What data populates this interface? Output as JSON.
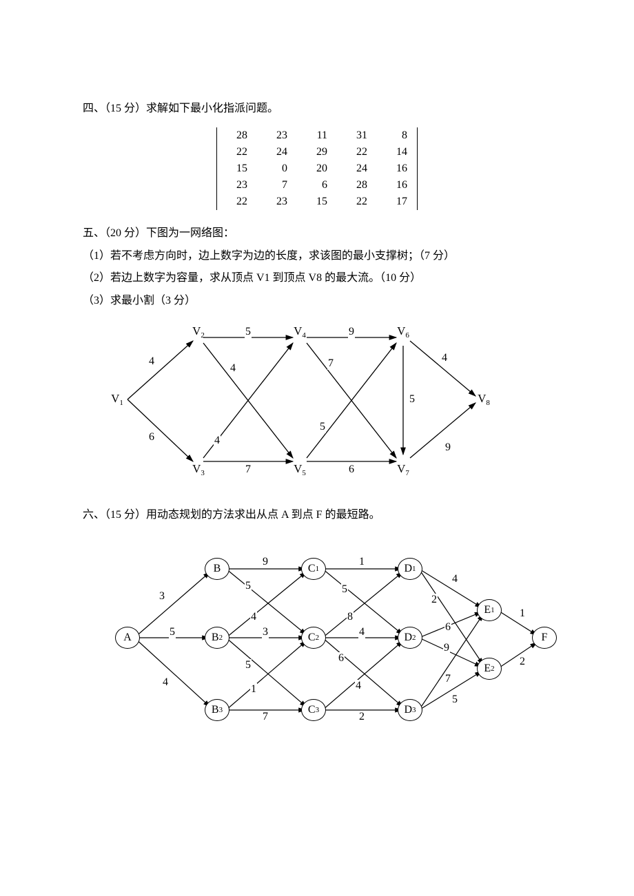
{
  "q4": {
    "heading": "四、（15 分）求解如下最小化指派问题。",
    "matrix": [
      [
        28,
        23,
        11,
        31,
        8
      ],
      [
        22,
        24,
        29,
        22,
        14
      ],
      [
        15,
        0,
        20,
        24,
        16
      ],
      [
        23,
        7,
        6,
        28,
        16
      ],
      [
        22,
        23,
        15,
        22,
        17
      ]
    ]
  },
  "q5": {
    "heading": "五、（20 分）下图为一网络图：",
    "sub1": "（1）若不考虑方向时，边上数字为边的长度，求该图的最小支撑树；（7 分）",
    "sub2": "（2）若边上数字为容量，求从顶点 V1 到顶点 V8 的最大流。（10 分）",
    "sub3": "（3）求最小割（3 分）",
    "nodes": [
      "V1",
      "V2",
      "V3",
      "V4",
      "V5",
      "V6",
      "V7",
      "V8"
    ],
    "edges": {
      "V1V2": 4,
      "V1V3": 6,
      "V2V4": 5,
      "V2V5": 4,
      "V3V4": 4,
      "V3V5": 7,
      "V4V6": 9,
      "V4V7": 7,
      "V5V6": 5,
      "V5V7": 6,
      "V6V7": 5,
      "V6V8": 4,
      "V7V8": 9
    }
  },
  "q6": {
    "heading": "六、（15 分）用动态规划的方法求出从点 A 到点 F 的最短路。",
    "nodes": [
      "A",
      "B",
      "B2",
      "B3",
      "C1",
      "C2",
      "C3",
      "D1",
      "D2",
      "D3",
      "E1",
      "E2",
      "F"
    ],
    "edges": {
      "A-B": 3,
      "A-B2": 5,
      "A-B3": 4,
      "B-C1": 9,
      "B-C2": 5,
      "B2-C1": 4,
      "B2-C2": 3,
      "B2-C3": 5,
      "B3-C2": 1,
      "B3-C3": 7,
      "C1-D1": 1,
      "C1-D2": 5,
      "C2-D1": 8,
      "C2-D2": 4,
      "C2-D3": 6,
      "C3-D2": 4,
      "C3-D3": 2,
      "D1-E1": 4,
      "D1-E2": 2,
      "D2-E1": 6,
      "D2-E2": 9,
      "D3-E1": 7,
      "D3-E2": 5,
      "E1-F": 1,
      "E2-F": 2
    }
  }
}
